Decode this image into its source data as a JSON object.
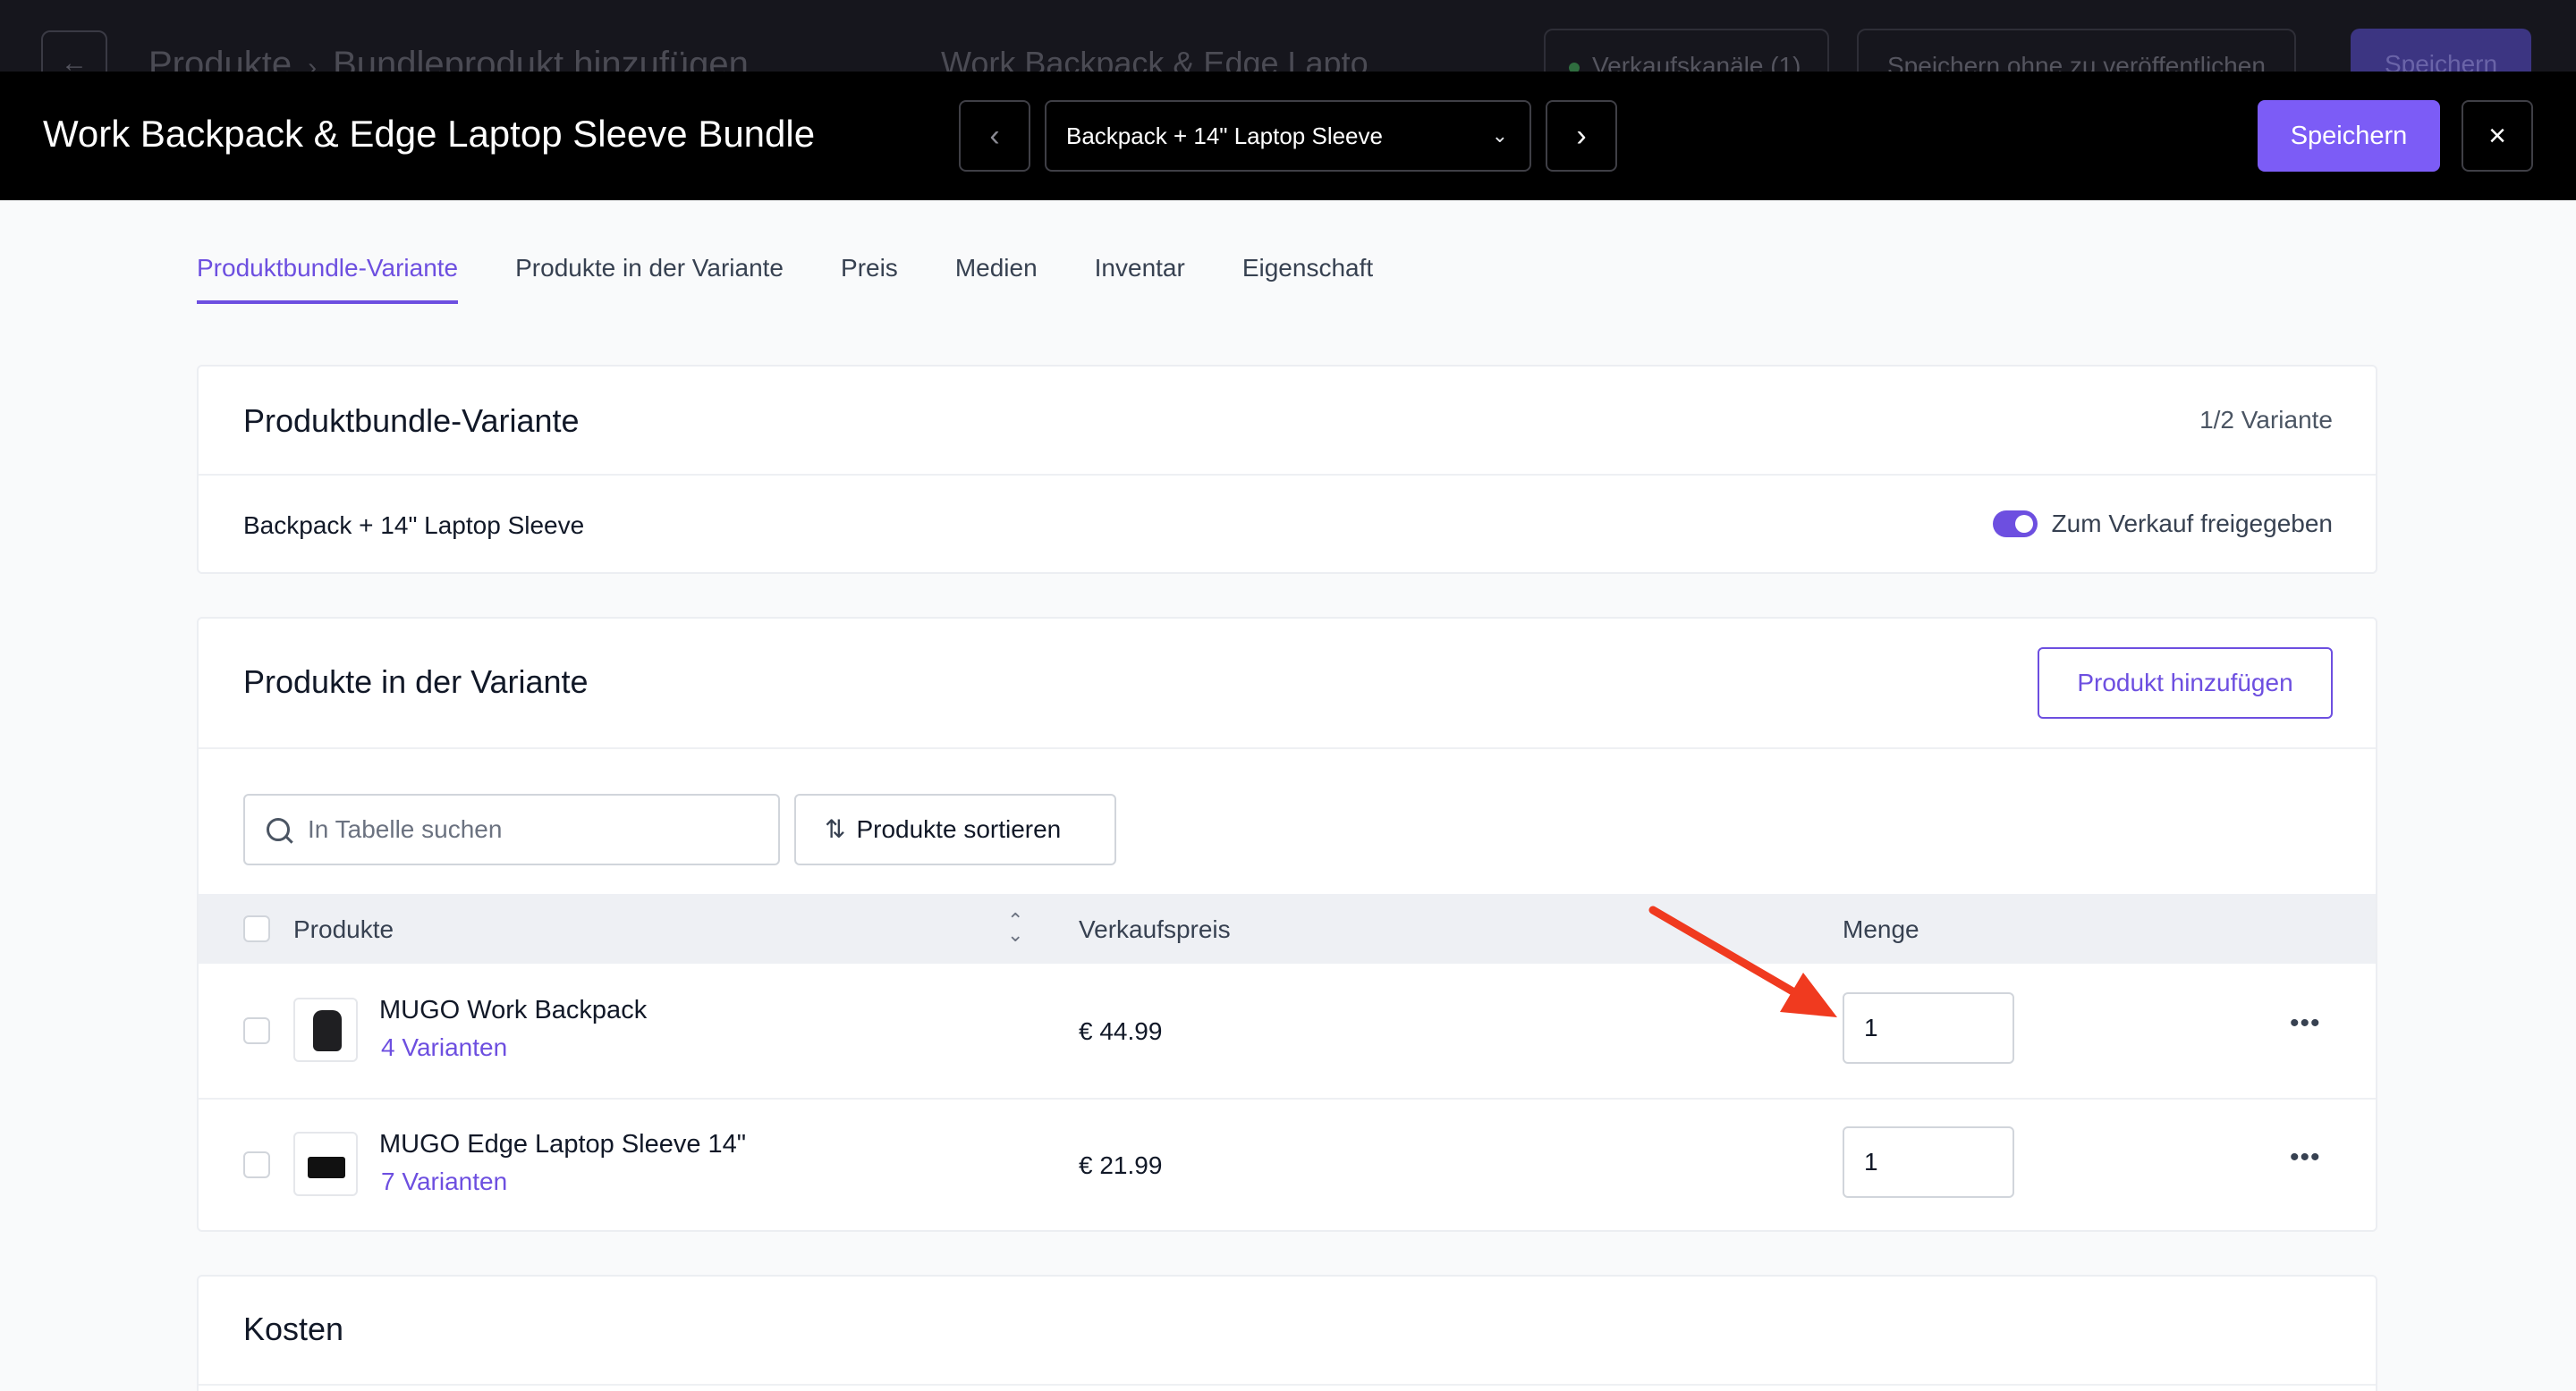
{
  "background": {
    "breadcrumb": [
      "Produkte",
      "Bundleprodukt hinzufügen"
    ],
    "product_title": "Work Backpack & Edge Lapto",
    "channels_label": "Verkaufskanäle (1)",
    "save_without_publish_label": "Speichern ohne zu veröffentlichen",
    "save_label": "Speichern"
  },
  "header": {
    "title": "Work Backpack & Edge Laptop Sleeve Bundle",
    "variant_selected": "Backpack + 14\" Laptop Sleeve",
    "save_label": "Speichern",
    "close_icon": "×"
  },
  "tabs": [
    {
      "label": "Produktbundle-Variante",
      "active": true
    },
    {
      "label": "Produkte in der Variante",
      "active": false
    },
    {
      "label": "Preis",
      "active": false
    },
    {
      "label": "Medien",
      "active": false
    },
    {
      "label": "Inventar",
      "active": false
    },
    {
      "label": "Eigenschaft",
      "active": false
    }
  ],
  "variant_card": {
    "title": "Produktbundle-Variante",
    "count": "1/2 Variante",
    "name": "Backpack + 14\" Laptop Sleeve",
    "sale_label": "Zum Verkauf freigegeben",
    "for_sale": true
  },
  "products_card": {
    "title": "Produkte in der Variante",
    "add_button": "Produkt hinzufügen",
    "search_placeholder": "In Tabelle suchen",
    "sort_button": "Produkte sortieren",
    "columns": [
      "Produkte",
      "Verkaufspreis",
      "Menge"
    ],
    "rows": [
      {
        "name": "MUGO Work Backpack",
        "variants": "4 Varianten",
        "price": "€ 44.99",
        "quantity": "1"
      },
      {
        "name": "MUGO Edge Laptop Sleeve 14\"",
        "variants": "7 Varianten",
        "price": "€ 21.99",
        "quantity": "1"
      }
    ]
  },
  "costs_card": {
    "title": "Kosten"
  },
  "colors": {
    "accent": "#7c5cf6",
    "annotation": "#f03a1f"
  }
}
